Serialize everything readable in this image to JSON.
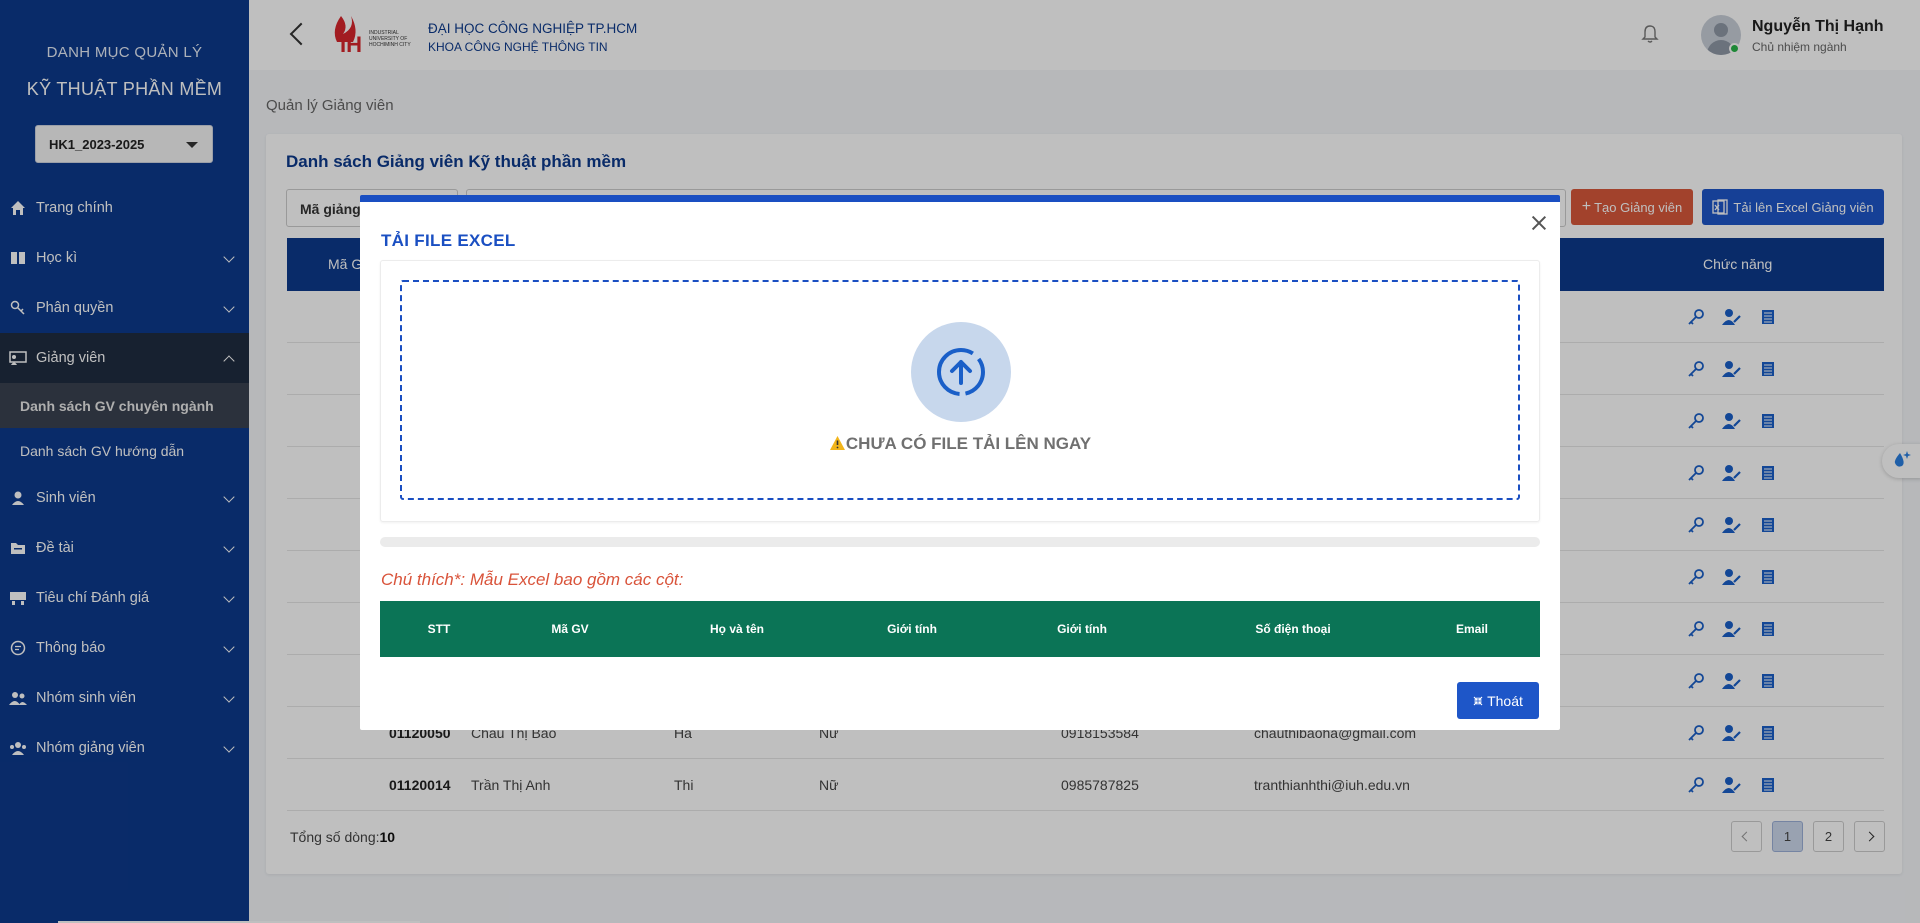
{
  "sidebar": {
    "title1": "DANH MỤC QUẢN LÝ",
    "title2": "KỸ THUẬT PHẦN MỀM",
    "semester": "HK1_2023-2025",
    "items": [
      {
        "label": "Trang chính",
        "icon": "home-icon"
      },
      {
        "label": "Học kì",
        "icon": "book-icon"
      },
      {
        "label": "Phân quyền",
        "icon": "key-icon"
      },
      {
        "label": "Giảng viên",
        "icon": "teacher-icon"
      },
      {
        "label": "Sinh viên",
        "icon": "student-icon"
      },
      {
        "label": "Đề tài",
        "icon": "folder-icon"
      },
      {
        "label": "Tiêu chí Đánh giá",
        "icon": "criteria-icon"
      },
      {
        "label": "Thông báo",
        "icon": "message-icon"
      },
      {
        "label": "Nhóm sinh viên",
        "icon": "group-icon"
      },
      {
        "label": "Nhóm giảng viên",
        "icon": "team-icon"
      }
    ],
    "subitems": [
      "Danh sách GV chuyên ngành",
      "Danh sách GV hướng dẫn"
    ]
  },
  "header": {
    "school_line1": "ĐẠI HỌC CÔNG NGHIỆP TP.HCM",
    "school_line2": "KHOA CÔNG NGHỆ THÔNG TIN",
    "logo_text": "IH",
    "logo_sub": "INDUSTRIAL UNIVERSITY OF HOCHIMINH CITY",
    "user_name": "Nguyễn Thị Hạnh",
    "user_role": "Chủ nhiệm ngành"
  },
  "page": {
    "breadcrumb": "Quản lý Giảng viên",
    "card_title": "Danh sách Giảng viên Kỹ thuật phần mềm",
    "filter_select": "Mã giảng",
    "create_button": "Tạo Giảng viên",
    "upload_button": "Tải lên Excel Giảng viên",
    "table_header_left": "Mã G",
    "table_header_actions": "Chức năng",
    "rows": [
      {
        "id": "",
        "name": "",
        "first": "",
        "gender": "",
        "phone": "",
        "email": ""
      },
      {
        "id": "",
        "name": "",
        "first": "",
        "gender": "",
        "phone": "",
        "email": ""
      },
      {
        "id": "",
        "name": "",
        "first": "",
        "gender": "",
        "phone": "",
        "email": ""
      },
      {
        "id": "",
        "name": "",
        "first": "",
        "gender": "",
        "phone": "",
        "email": ""
      },
      {
        "id": "",
        "name": "",
        "first": "",
        "gender": "",
        "phone": "",
        "email": ""
      },
      {
        "id": "",
        "name": "",
        "first": "",
        "gender": "",
        "phone": "",
        "email": ""
      },
      {
        "id": "",
        "name": "",
        "first": "",
        "gender": "",
        "phone": "",
        "email": ""
      },
      {
        "id": "",
        "name": "",
        "first": "",
        "gender": "",
        "phone": "",
        "email": ""
      },
      {
        "id": "01120050",
        "name": "Châu Thị Bảo",
        "first": "Hà",
        "gender": "Nữ",
        "phone": "0918153584",
        "email": "chauthibaoha@gmail.com"
      },
      {
        "id": "01120014",
        "name": "Trần Thị Anh",
        "first": "Thi",
        "gender": "Nữ",
        "phone": "0985787825",
        "email": "tranthianhthi@iuh.edu.vn"
      }
    ],
    "total_label": "Tổng số dòng:",
    "total_value": "10",
    "pages": [
      "1",
      "2"
    ]
  },
  "modal": {
    "title": "TẢI FILE EXCEL",
    "no_file": "CHƯA CÓ FILE TẢI LÊN NGAY",
    "note": "Chú thích*: Mẫu Excel bao gồm các cột:",
    "columns": [
      "STT",
      "Mã GV",
      "Họ và tên",
      "Giới tính",
      "Giới tính",
      "Số điện thoại",
      "Email"
    ],
    "exit_button": "Thoát",
    "progress": 0
  },
  "colors": {
    "sidebar": "#0d3a8c",
    "primary": "#1a4fc2",
    "danger": "#d9583b",
    "excel_header": "#0b7456"
  }
}
